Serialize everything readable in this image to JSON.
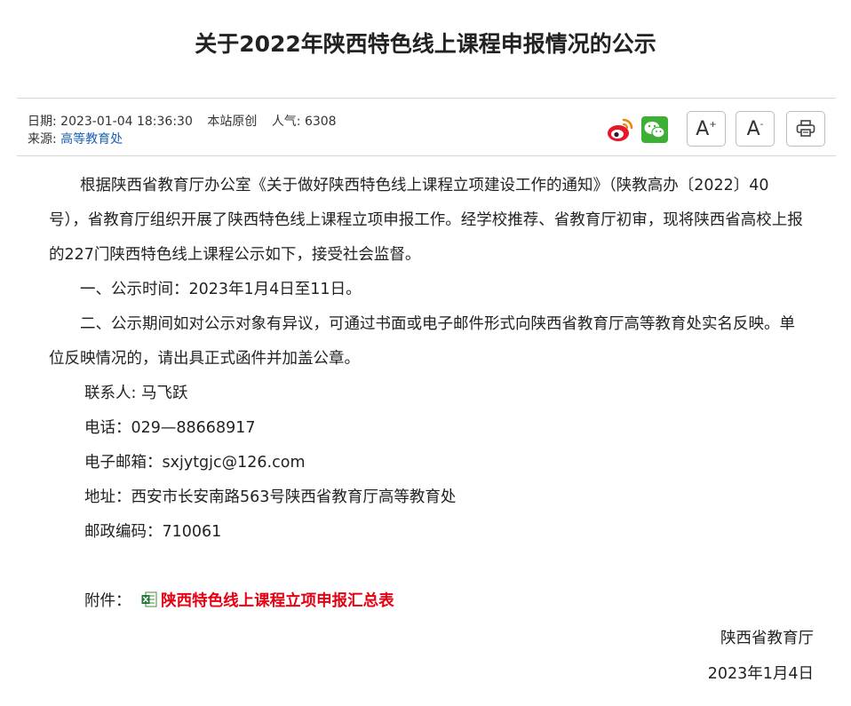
{
  "article": {
    "title": "关于2022年陕西特色线上课程申报情况的公示"
  },
  "meta": {
    "date_label": "日期:",
    "date_value": "2023-01-04 18:36:30",
    "origin": "本站原创",
    "views_label": "人气:",
    "views_value": "6308",
    "source_label": "来源:",
    "source_link": "高等教育处"
  },
  "share": {
    "weibo_icon": "weibo-icon",
    "wechat_icon": "wechat-icon"
  },
  "tools": {
    "font_up_label": "A",
    "font_up_sup": "+",
    "font_down_label": "A",
    "font_down_sup": "-",
    "print_icon": "printer-icon"
  },
  "body": {
    "para1": "根据陕西省教育厅办公室《关于做好陕西特色线上课程立项建设工作的通知》（陕教高办〔2022〕40号），省教育厅组织开展了陕西特色线上课程立项申报工作。经学校推荐、省教育厅初审，现将陕西省高校上报的227门陕西特色线上课程公示如下，接受社会监督。",
    "item1": "一、公示时间：2023年1月4日至11日。",
    "item2": "二、公示期间如对公示对象有异议，可通过书面或电子邮件形式向陕西省教育厅高等教育处实名反映。单位反映情况的，请出具正式函件并加盖公章。",
    "contact": "联系人: 马飞跃",
    "phone": "电话：029—88668917",
    "email": "电子邮箱：sxjytgjc@126.com",
    "address": "地址：西安市长安南路563号陕西省教育厅高等教育处",
    "postcode": "邮政编码：710061",
    "attach_label": "附件：",
    "attach_link": "陕西特色线上课程立项申报汇总表"
  },
  "signature": {
    "org": "陕西省教育厅",
    "date": "2023年1月4日"
  },
  "colors": {
    "link_blue": "#1a5fb4",
    "attach_red": "#e60012"
  }
}
